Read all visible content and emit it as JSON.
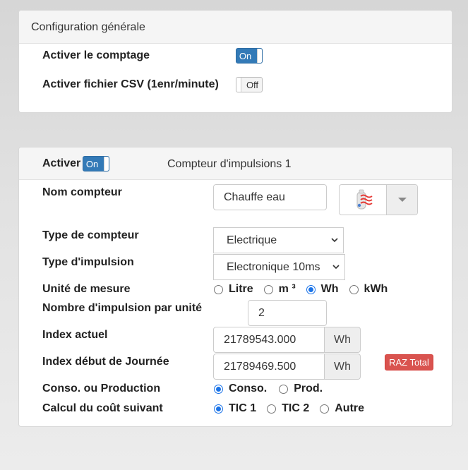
{
  "general": {
    "title": "Configuration générale",
    "enable_count_label": "Activer le comptage",
    "enable_count_state": "On",
    "csv_label": "Activer fichier CSV (1enr/minute)",
    "csv_state": "Off"
  },
  "counter": {
    "activate_label": "Activer",
    "activate_state": "On",
    "title": "Compteur d'impulsions 1",
    "name_label": "Nom compteur",
    "name_value": "Chauffe eau",
    "icon": "water-heater-icon",
    "type_label": "Type de compteur",
    "type_value": "Electrique",
    "impulse_label": "Type d'impulsion",
    "impulse_value": "Electronique 10ms",
    "unit_label": "Unité de mesure",
    "unit_options": [
      "Litre",
      "m ³",
      "Wh",
      "kWh"
    ],
    "unit_selected": "Wh",
    "per_unit_label": "Nombre d'impulsion par unité",
    "per_unit_value": "2",
    "index_label": "Index actuel",
    "index_value": "21789543.000",
    "index_unit": "Wh",
    "day_index_label": "Index début de Journée",
    "day_index_value": "21789469.500",
    "day_index_unit": "Wh",
    "raz_label": "RAZ Total",
    "conso_label": "Conso. ou Production",
    "conso_options": [
      "Conso.",
      "Prod."
    ],
    "conso_selected": "Conso.",
    "cost_label": "Calcul du coût suivant",
    "cost_options": [
      "TIC 1",
      "TIC 2",
      "Autre"
    ],
    "cost_selected": "TIC 1"
  },
  "colors": {
    "toggle_on": "#337ab7",
    "radio_checked": "#1a73e8",
    "raz_button": "#d9534f"
  }
}
